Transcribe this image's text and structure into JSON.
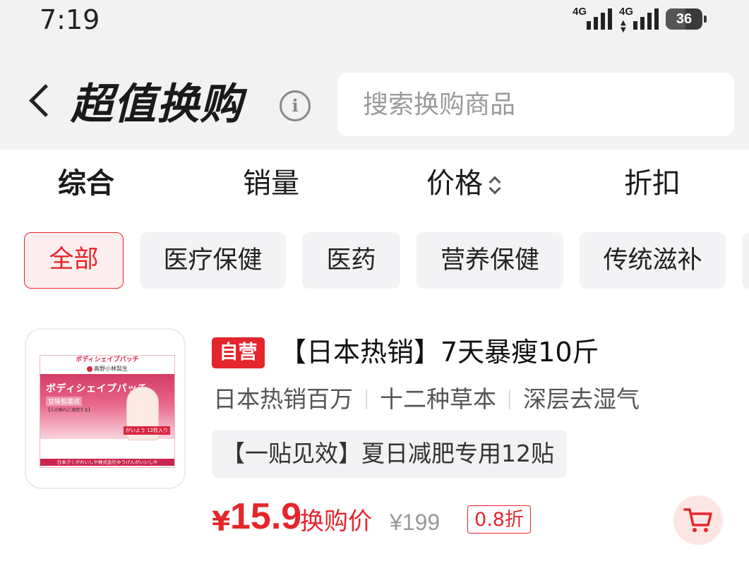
{
  "status_bar": {
    "time": "7:19",
    "signal_1": "4G",
    "signal_2": "4G",
    "battery": "36"
  },
  "header": {
    "title": "超值换购",
    "search_placeholder": "搜索换购商品"
  },
  "sort_tabs": [
    {
      "label": "综合",
      "active": true
    },
    {
      "label": "销量"
    },
    {
      "label": "价格"
    },
    {
      "label": "折扣"
    }
  ],
  "categories": [
    {
      "label": "全部",
      "active": true
    },
    {
      "label": "医疗保健"
    },
    {
      "label": "医药"
    },
    {
      "label": "营养保健"
    },
    {
      "label": "传统滋补"
    }
  ],
  "product": {
    "badge": "自营",
    "title": "【日本热销】7天暴瘦10斤",
    "tags": [
      "日本热销百万",
      "十二种草本",
      "深层去湿气"
    ],
    "promo": "【一贴见效】夏日减肥专用12贴",
    "price_symbol": "¥",
    "price": "15.9",
    "price_label": "换购价",
    "original_price": "¥199",
    "discount": "0.8折",
    "package": {
      "top_text": "ボディシェイプパッチ",
      "brand": "高野小林製生",
      "name": "ボディシェイプパッチ",
      "sub": "甘味製薬成",
      "text": "【人の鮮れに適用する】",
      "tag": "がいよう 12枚入り",
      "bottom": "日本ざくがわいしや株式会社ゆうげんがいいしや"
    }
  },
  "colors": {
    "accent": "#e4262c",
    "header_bg": "#f2f2f2",
    "chip_bg": "#f3f3f5",
    "active_chip_bg": "#fdeff0",
    "cart_bg": "#fde5e3"
  },
  "icons": {
    "back": "chevron-left-icon",
    "info": "info-icon",
    "sort": "sort-arrows-icon",
    "cart": "cart-icon"
  }
}
